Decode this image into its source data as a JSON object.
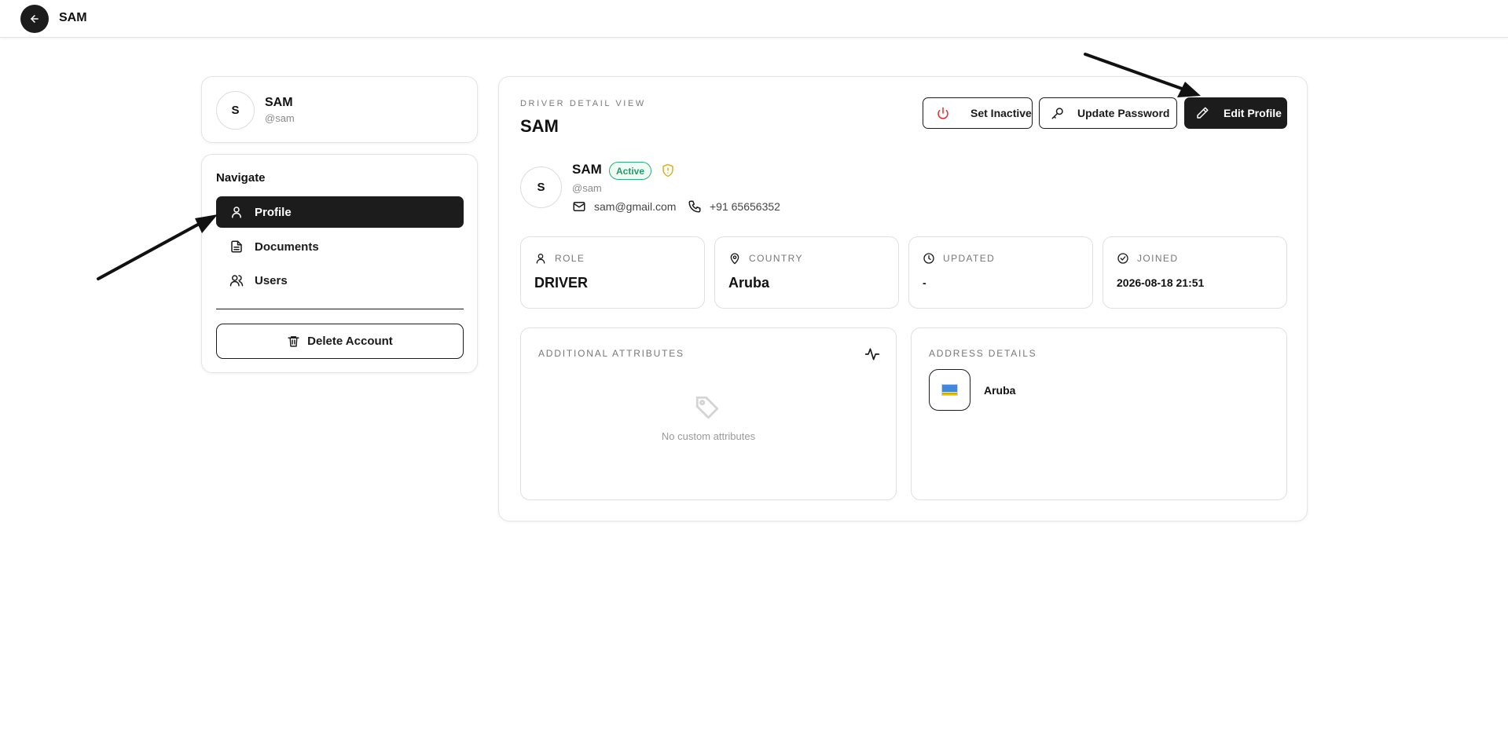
{
  "topbar": {
    "title": "SAM"
  },
  "user_card": {
    "initial": "S",
    "name": "SAM",
    "handle": "@sam"
  },
  "nav": {
    "heading": "Navigate",
    "items": [
      {
        "label": "Profile",
        "icon": "user-icon",
        "active": true
      },
      {
        "label": "Documents",
        "icon": "file-icon",
        "active": false
      },
      {
        "label": "Users",
        "icon": "users-icon",
        "active": false
      }
    ],
    "delete_label": "Delete Account"
  },
  "main": {
    "eyebrow": "DRIVER DETAIL VIEW",
    "title": "SAM",
    "actions": {
      "set_inactive": "Set Inactive",
      "update_password": "Update Password",
      "edit_profile": "Edit Profile"
    },
    "profile": {
      "initial": "S",
      "name": "SAM",
      "status": "Active",
      "handle": "@sam",
      "email": "sam@gmail.com",
      "phone": "+91 65656352"
    },
    "stats": {
      "role": {
        "label": "ROLE",
        "value": "DRIVER"
      },
      "country": {
        "label": "COUNTRY",
        "value": "Aruba"
      },
      "updated": {
        "label": "UPDATED",
        "value": "-"
      },
      "joined": {
        "label": "JOINED",
        "value": "2026-08-18 21:51"
      }
    },
    "attributes": {
      "label": "ADDITIONAL ATTRIBUTES",
      "empty": "No custom attributes"
    },
    "address": {
      "label": "ADDRESS DETAILS",
      "country": "Aruba",
      "flag_icon": "aruba-flag-icon"
    }
  },
  "colors": {
    "dark": "#1c1c1c",
    "active_green": "#1f9d6a",
    "power_red": "#e0302f",
    "shield_yellow": "#e0b020"
  }
}
